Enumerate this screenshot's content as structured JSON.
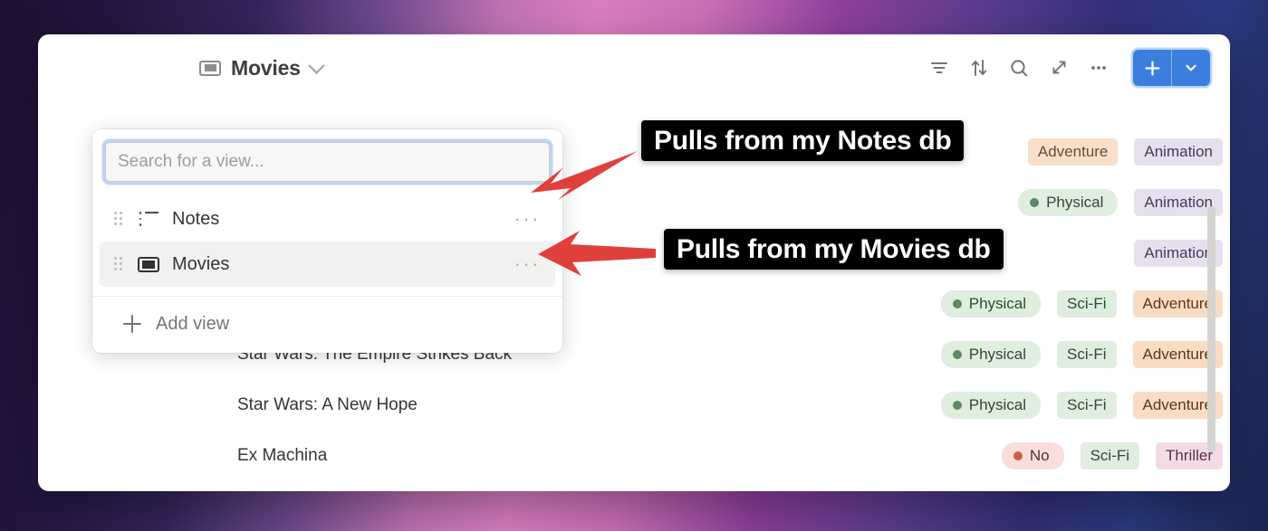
{
  "header": {
    "view_icon": "ticket-icon",
    "view_title": "Movies",
    "chevron": "chevron-down-icon"
  },
  "toolbar": {
    "filter_label": "Filter",
    "sort_label": "Sort",
    "search_label": "Search",
    "expand_label": "Expand",
    "more_label": "…",
    "new_label": "New",
    "new_caret_label": "New options",
    "accent_color": "#3b7edd"
  },
  "popover": {
    "search": {
      "value": "",
      "placeholder": "Search for a view..."
    },
    "views": [
      {
        "icon": "list-icon",
        "label": "Notes",
        "selected": false,
        "more": "···"
      },
      {
        "icon": "ticket-icon",
        "label": "Movies",
        "selected": true,
        "more": "···"
      }
    ],
    "add_view_label": "Add view"
  },
  "table": {
    "rows": [
      {
        "title": "",
        "tags": [
          {
            "text": "Adventure",
            "style": "orange",
            "dot": null,
            "occluded": true
          },
          {
            "text": "Animation",
            "style": "purple",
            "dot": null,
            "occluded": false
          }
        ]
      },
      {
        "title": "",
        "tags": [
          {
            "text": "Physical",
            "style": "green-pill",
            "dot": "#5f8a63",
            "occluded": false
          },
          {
            "text": "Animation",
            "style": "purple",
            "dot": null,
            "occluded": false
          }
        ]
      },
      {
        "title": "",
        "tags": [
          {
            "text": "Animation",
            "style": "purple",
            "dot": null,
            "occluded": false
          }
        ]
      },
      {
        "title": "",
        "tags": [
          {
            "text": "Physical",
            "style": "green-pill",
            "dot": "#5f8a63",
            "occluded": false
          },
          {
            "text": "Sci-Fi",
            "style": "green",
            "dot": null,
            "occluded": false
          },
          {
            "text": "Adventure",
            "style": "orange",
            "dot": null,
            "occluded": false
          }
        ]
      },
      {
        "title": "Star Wars: The Empire Strikes Back",
        "tags": [
          {
            "text": "Physical",
            "style": "green-pill",
            "dot": "#5f8a63",
            "occluded": false
          },
          {
            "text": "Sci-Fi",
            "style": "green",
            "dot": null,
            "occluded": false
          },
          {
            "text": "Adventure",
            "style": "orange",
            "dot": null,
            "occluded": false
          }
        ]
      },
      {
        "title": "Star Wars: A New Hope",
        "tags": [
          {
            "text": "Physical",
            "style": "green-pill",
            "dot": "#5f8a63",
            "occluded": false
          },
          {
            "text": "Sci-Fi",
            "style": "green",
            "dot": null,
            "occluded": false
          },
          {
            "text": "Adventure",
            "style": "orange",
            "dot": null,
            "occluded": false
          }
        ]
      },
      {
        "title": "Ex Machina",
        "tags": [
          {
            "text": "No",
            "style": "red-pill",
            "dot": "#cd5f4a",
            "occluded": false
          },
          {
            "text": "Sci-Fi",
            "style": "green",
            "dot": null,
            "occluded": false
          },
          {
            "text": "Thriller",
            "style": "pink",
            "dot": null,
            "occluded": false
          }
        ]
      }
    ],
    "tag_colors": {
      "green": {
        "bg": "#dfeedf",
        "fg": "#2f4a33"
      },
      "green-pill": {
        "bg": "#dfeedf",
        "fg": "#2f4a33"
      },
      "purple": {
        "bg": "#e6e0ee",
        "fg": "#463a5c"
      },
      "orange": {
        "bg": "#f8dcc4",
        "fg": "#5c3a1c"
      },
      "pink": {
        "bg": "#f3dbe6",
        "fg": "#543447"
      },
      "red-pill": {
        "bg": "#fadedb",
        "fg": "#5c2f27"
      }
    }
  },
  "annotations": [
    {
      "id": "notes",
      "text": "Pulls from my Notes db",
      "arrow": "arrow-down-left",
      "color": "#e0403c"
    },
    {
      "id": "movies",
      "text": "Pulls from my Movies db",
      "arrow": "arrow-left",
      "color": "#e0403c"
    }
  ],
  "scrollbar": {
    "name": "vertical-scrollbar"
  }
}
